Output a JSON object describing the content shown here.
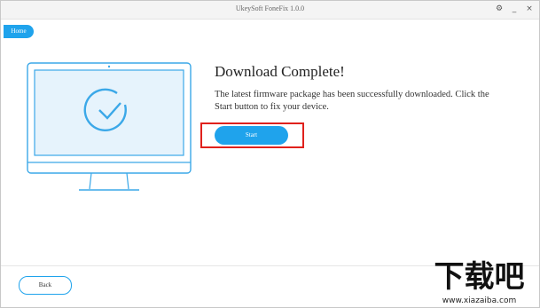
{
  "window": {
    "title": "UkeySoft FoneFix 1.0.0",
    "controls": {
      "settings": "⚙",
      "minimize": "_",
      "close": "×"
    }
  },
  "nav": {
    "home_label": "Home"
  },
  "main": {
    "heading": "Download Complete!",
    "message": "The latest firmware package has been successfully downloaded. Click the Start button to fix your device.",
    "start_label": "Start"
  },
  "footer": {
    "back_label": "Back"
  },
  "watermark": {
    "logo": "下载吧",
    "url": "www.xiazaiba.com"
  },
  "colors": {
    "accent": "#1fa3ec",
    "highlight": "#e0211c",
    "monitor_screen": "#e6f3fc",
    "monitor_line": "#3ba8e8"
  },
  "icons": {
    "monitor": "monitor-icon",
    "check": "checkmark-circle-icon"
  }
}
